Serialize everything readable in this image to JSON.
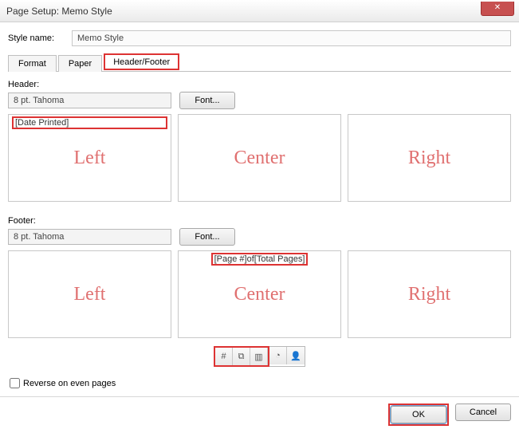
{
  "title": "Page Setup: Memo Style",
  "styleNameLabel": "Style name:",
  "styleName": "Memo Style",
  "tabs": {
    "format": "Format",
    "paper": "Paper",
    "headerFooter": "Header/Footer"
  },
  "header": {
    "label": "Header:",
    "font": "8 pt. Tahoma",
    "fontBtn": "Font...",
    "left": "[Date Printed]",
    "center": "",
    "right": ""
  },
  "footer": {
    "label": "Footer:",
    "font": "8 pt. Tahoma",
    "fontBtn": "Font...",
    "left": "",
    "center": "[Page #]of[Total Pages]",
    "right": ""
  },
  "overprint": {
    "left": "Left",
    "center": "Center",
    "right": "Right"
  },
  "toolbarIcons": {
    "pageNum": "#",
    "totalPages": "⧉",
    "dateRange": "▥",
    "clock": "◔",
    "user": "👤"
  },
  "reverseLabel": "Reverse on even pages",
  "buttons": {
    "ok": "OK",
    "cancel": "Cancel"
  }
}
